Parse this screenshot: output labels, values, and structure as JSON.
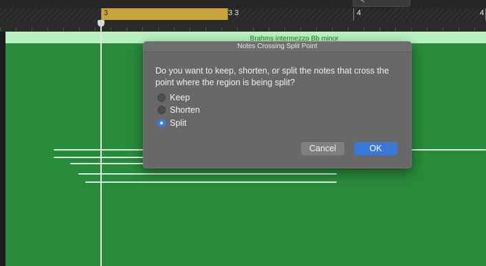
{
  "ruler": {
    "bar_labels": [
      "3",
      "3 3",
      "4",
      "4"
    ]
  },
  "region": {
    "name": "Brahms intermezzo Bb minor"
  },
  "dialog": {
    "title": "Notes Crossing Split Point",
    "message": "Do you want to keep, shorten, or split the notes that cross the point where the region is being split?",
    "options": [
      {
        "label": "Keep",
        "selected": false
      },
      {
        "label": "Shorten",
        "selected": false
      },
      {
        "label": "Split",
        "selected": true
      }
    ],
    "cancel_label": "Cancel",
    "ok_label": "OK"
  },
  "colors": {
    "region_green": "#2a8a3c",
    "region_header": "#b9f2c0",
    "cycle_region": "#c9a33c",
    "accent_blue": "#3878d8",
    "dialog_bg": "#686868"
  },
  "icons": {
    "tool_picker": "pointer-tool-icon"
  }
}
